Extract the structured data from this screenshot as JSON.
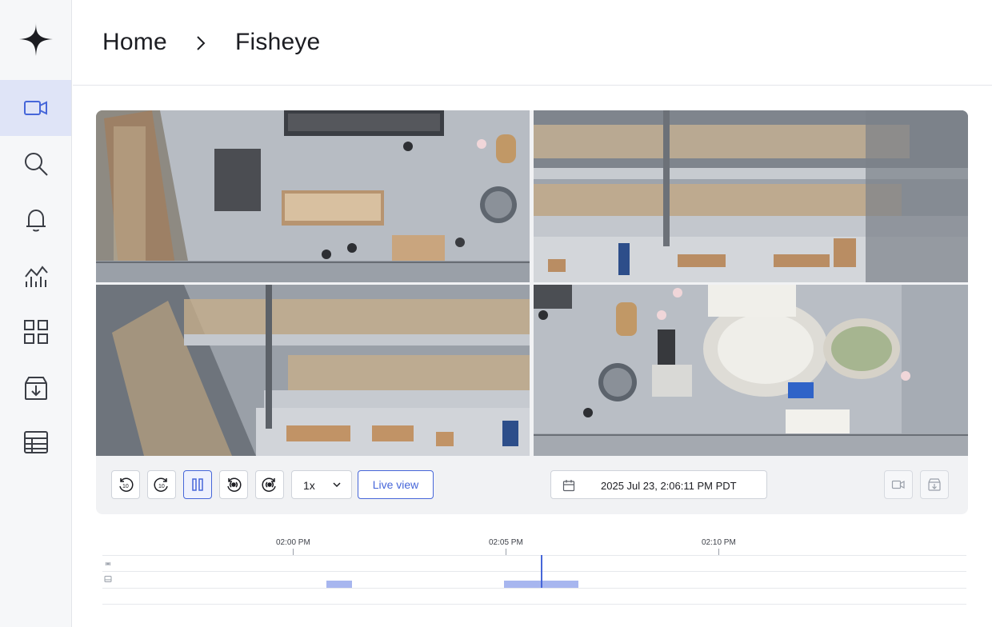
{
  "sidebar": {
    "items": [
      {
        "name": "cameras",
        "icon": "video-camera-icon",
        "active": true
      },
      {
        "name": "search",
        "icon": "search-icon",
        "active": false
      },
      {
        "name": "alerts",
        "icon": "bell-icon",
        "active": false
      },
      {
        "name": "analytics",
        "icon": "chart-icon",
        "active": false
      },
      {
        "name": "dashboard",
        "icon": "grid-icon",
        "active": false
      },
      {
        "name": "archive",
        "icon": "archive-download-icon",
        "active": false
      },
      {
        "name": "table",
        "icon": "table-icon",
        "active": false
      }
    ]
  },
  "breadcrumb": {
    "home": "Home",
    "current": "Fisheye"
  },
  "player": {
    "speed": "1x",
    "live_view_label": "Live view",
    "datetime": "2025 Jul 23, 2:06:11 PM PDT"
  },
  "timeline": {
    "ticks": [
      "02:00 PM",
      "02:05 PM",
      "02:10 PM"
    ]
  },
  "colors": {
    "accent": "#4666d9",
    "active_nav_bg": "#dfe4f7",
    "recording_block": "#a7b6ef"
  }
}
